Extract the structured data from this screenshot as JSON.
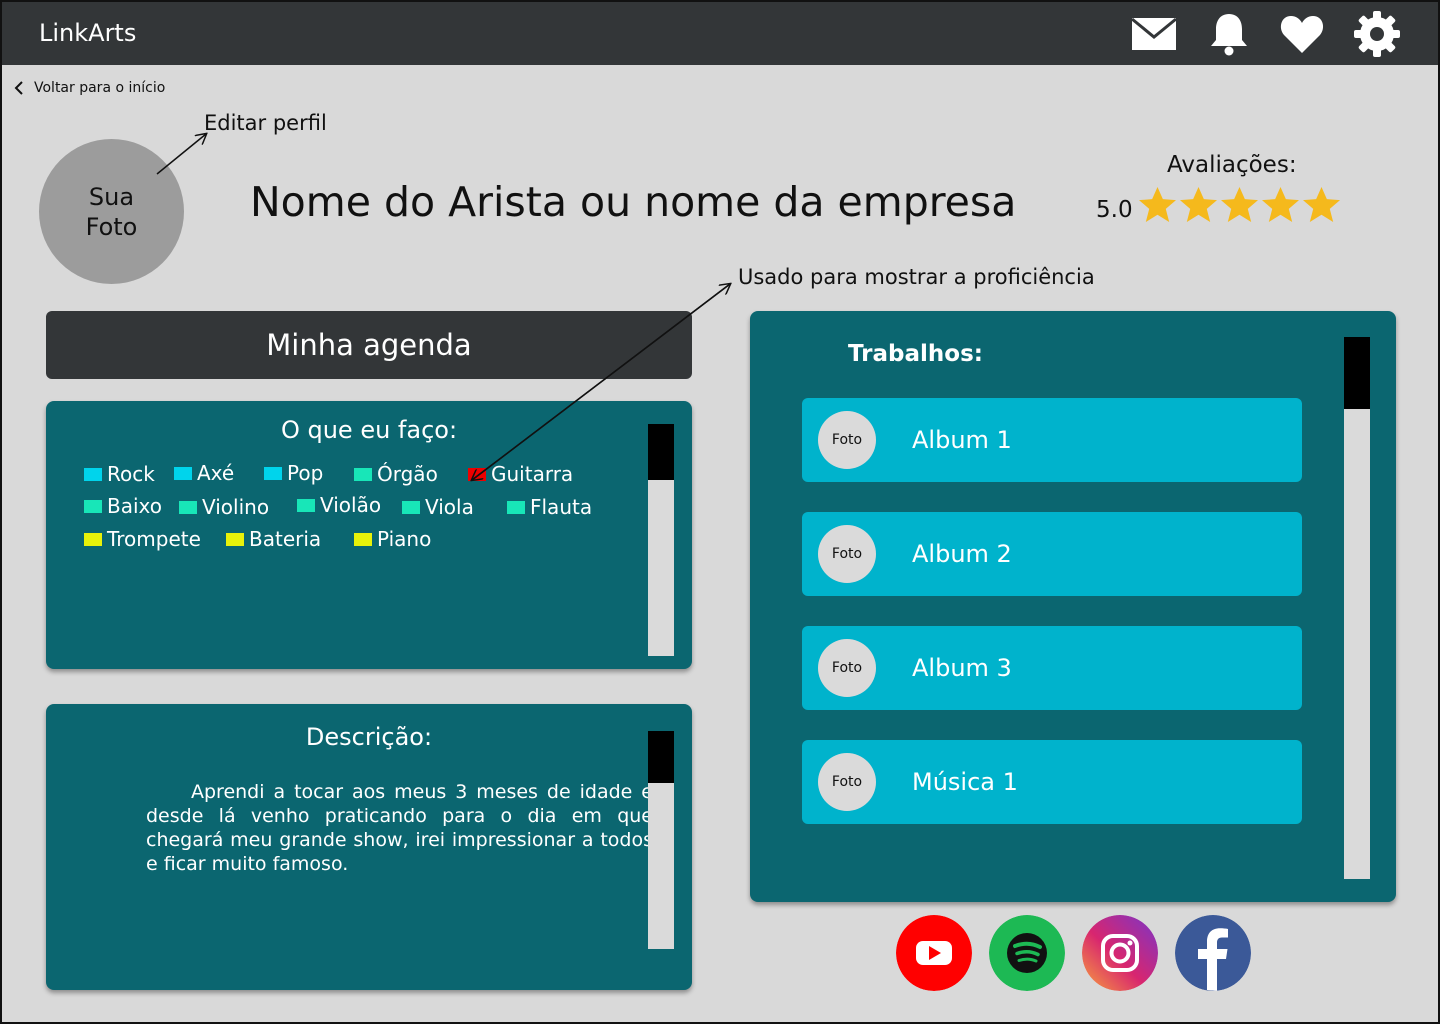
{
  "header": {
    "brand": "LinkArts",
    "icons": [
      "mail-icon",
      "bell-icon",
      "heart-icon",
      "gear-icon"
    ]
  },
  "nav": {
    "back_label": "Voltar para o início"
  },
  "annotations": {
    "edit_profile": "Editar perfil",
    "proficiency_note": "Usado para mostrar a proficiência"
  },
  "profile": {
    "photo_line1": "Sua",
    "photo_line2": "Foto",
    "name": "Nome do Arista ou nome da empresa"
  },
  "rating": {
    "label": "Avaliações:",
    "value": "5.0",
    "stars": 5,
    "star_color": "#f5b91c"
  },
  "agenda": {
    "label": "Minha agenda"
  },
  "skills": {
    "title": "O que eu faço:",
    "items": [
      {
        "label": "Rock",
        "color": "#00d4ec"
      },
      {
        "label": "Axé",
        "color": "#00d4ec"
      },
      {
        "label": "Pop",
        "color": "#00d4ec"
      },
      {
        "label": "Órgão",
        "color": "#18e6b8"
      },
      {
        "label": "Guitarra",
        "color": "#ee0000"
      },
      {
        "label": "Baixo",
        "color": "#18e6b8"
      },
      {
        "label": "Violino",
        "color": "#18e6b8"
      },
      {
        "label": "Violão",
        "color": "#18e6b8"
      },
      {
        "label": "Viola",
        "color": "#18e6b8"
      },
      {
        "label": "Flauta",
        "color": "#18e6b8"
      },
      {
        "label": "Trompete",
        "color": "#e8f20a"
      },
      {
        "label": "Bateria",
        "color": "#e8f20a"
      },
      {
        "label": "Piano",
        "color": "#e8f20a"
      }
    ]
  },
  "description": {
    "title": "Descrição:",
    "text": "Aprendi a tocar aos meus 3 meses de idade e desde lá venho praticando para o dia em que chegará meu grande show, irei impressionar a todos e ficar muito famoso."
  },
  "works": {
    "title": "Trabalhos:",
    "items": [
      {
        "photo": "Foto",
        "label": "Album 1"
      },
      {
        "photo": "Foto",
        "label": "Album 2"
      },
      {
        "photo": "Foto",
        "label": "Album 3"
      },
      {
        "photo": "Foto",
        "label": "Música 1"
      }
    ]
  },
  "social": [
    {
      "name": "youtube-icon",
      "color": "#ff0000"
    },
    {
      "name": "spotify-icon",
      "color": "#1db954"
    },
    {
      "name": "instagram-icon",
      "color": "#c13584"
    },
    {
      "name": "facebook-icon",
      "color": "#3b5998"
    }
  ],
  "colors": {
    "topbar": "#333638",
    "panel": "#0b6670",
    "work_item": "#00b3cc",
    "background": "#d9d9d9"
  }
}
